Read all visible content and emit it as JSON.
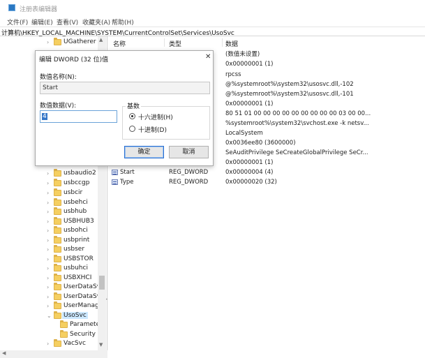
{
  "window": {
    "title": "注册表编辑器"
  },
  "menu": [
    "文件(F)",
    "编辑(E)",
    "查看(V)",
    "收藏夹(A)",
    "帮助(H)"
  ],
  "address": "计算机\\HKEY_LOCAL_MACHINE\\SYSTEM\\CurrentControlSet\\Services\\UsoSvc",
  "tree": {
    "items": [
      {
        "label": "UGatherer",
        "expander": "›"
      },
      {
        "label": "usbaudio2",
        "expander": "›"
      },
      {
        "label": "usbccgp",
        "expander": "›"
      },
      {
        "label": "usbcir",
        "expander": "›"
      },
      {
        "label": "usbehci",
        "expander": "›"
      },
      {
        "label": "usbhub",
        "expander": "›"
      },
      {
        "label": "USBHUB3",
        "expander": "›"
      },
      {
        "label": "usbohci",
        "expander": "›"
      },
      {
        "label": "usbprint",
        "expander": "›"
      },
      {
        "label": "usbser",
        "expander": "›"
      },
      {
        "label": "USBSTOR",
        "expander": "›"
      },
      {
        "label": "usbuhci",
        "expander": "›"
      },
      {
        "label": "USBXHCI",
        "expander": "›"
      },
      {
        "label": "UserDataSvc",
        "expander": "›"
      },
      {
        "label": "UserDataSvc_",
        "expander": "›"
      },
      {
        "label": "UserManage",
        "expander": "›"
      },
      {
        "label": "UsoSvc",
        "expander": "⌄",
        "selected": true
      },
      {
        "label": "Parameter",
        "expander": ""
      },
      {
        "label": "Security",
        "expander": ""
      },
      {
        "label": "VacSvc",
        "expander": "›"
      }
    ]
  },
  "list": {
    "headers": {
      "name": "名称",
      "type": "类型",
      "data": "数据"
    },
    "data_values": [
      "(数值未设置)",
      "0x00000001 (1)",
      "rpcss",
      "@%systemroot%\\system32\\usosvc.dll,-102",
      "@%systemroot%\\system32\\usosvc.dll,-101",
      "0x00000001 (1)",
      "80 51 01 00 00 00 00 00 00 00 00 00 03 00 00...",
      "%systemroot%\\system32\\svchost.exe -k netsv...",
      "LocalSystem",
      "0x0036ee80 (3600000)",
      "SeAuditPrivilege SeCreateGlobalPrivilege SeCr...",
      "0x00000001 (1)"
    ],
    "rows": [
      {
        "name": "Start",
        "type": "REG_DWORD",
        "data": "0x00000004 (4)"
      },
      {
        "name": "Type",
        "type": "REG_DWORD",
        "data": "0x00000020 (32)"
      }
    ]
  },
  "dialog": {
    "title": "编辑 DWORD (32 位)值",
    "close": "✕",
    "name_label": "数值名称(N):",
    "name_value": "Start",
    "value_label": "数值数据(V):",
    "value": "4",
    "base_label": "基数",
    "hex_label": "十六进制(H)",
    "dec_label": "十进制(D)",
    "base_selected": "hex",
    "ok": "确定",
    "cancel": "取消"
  }
}
